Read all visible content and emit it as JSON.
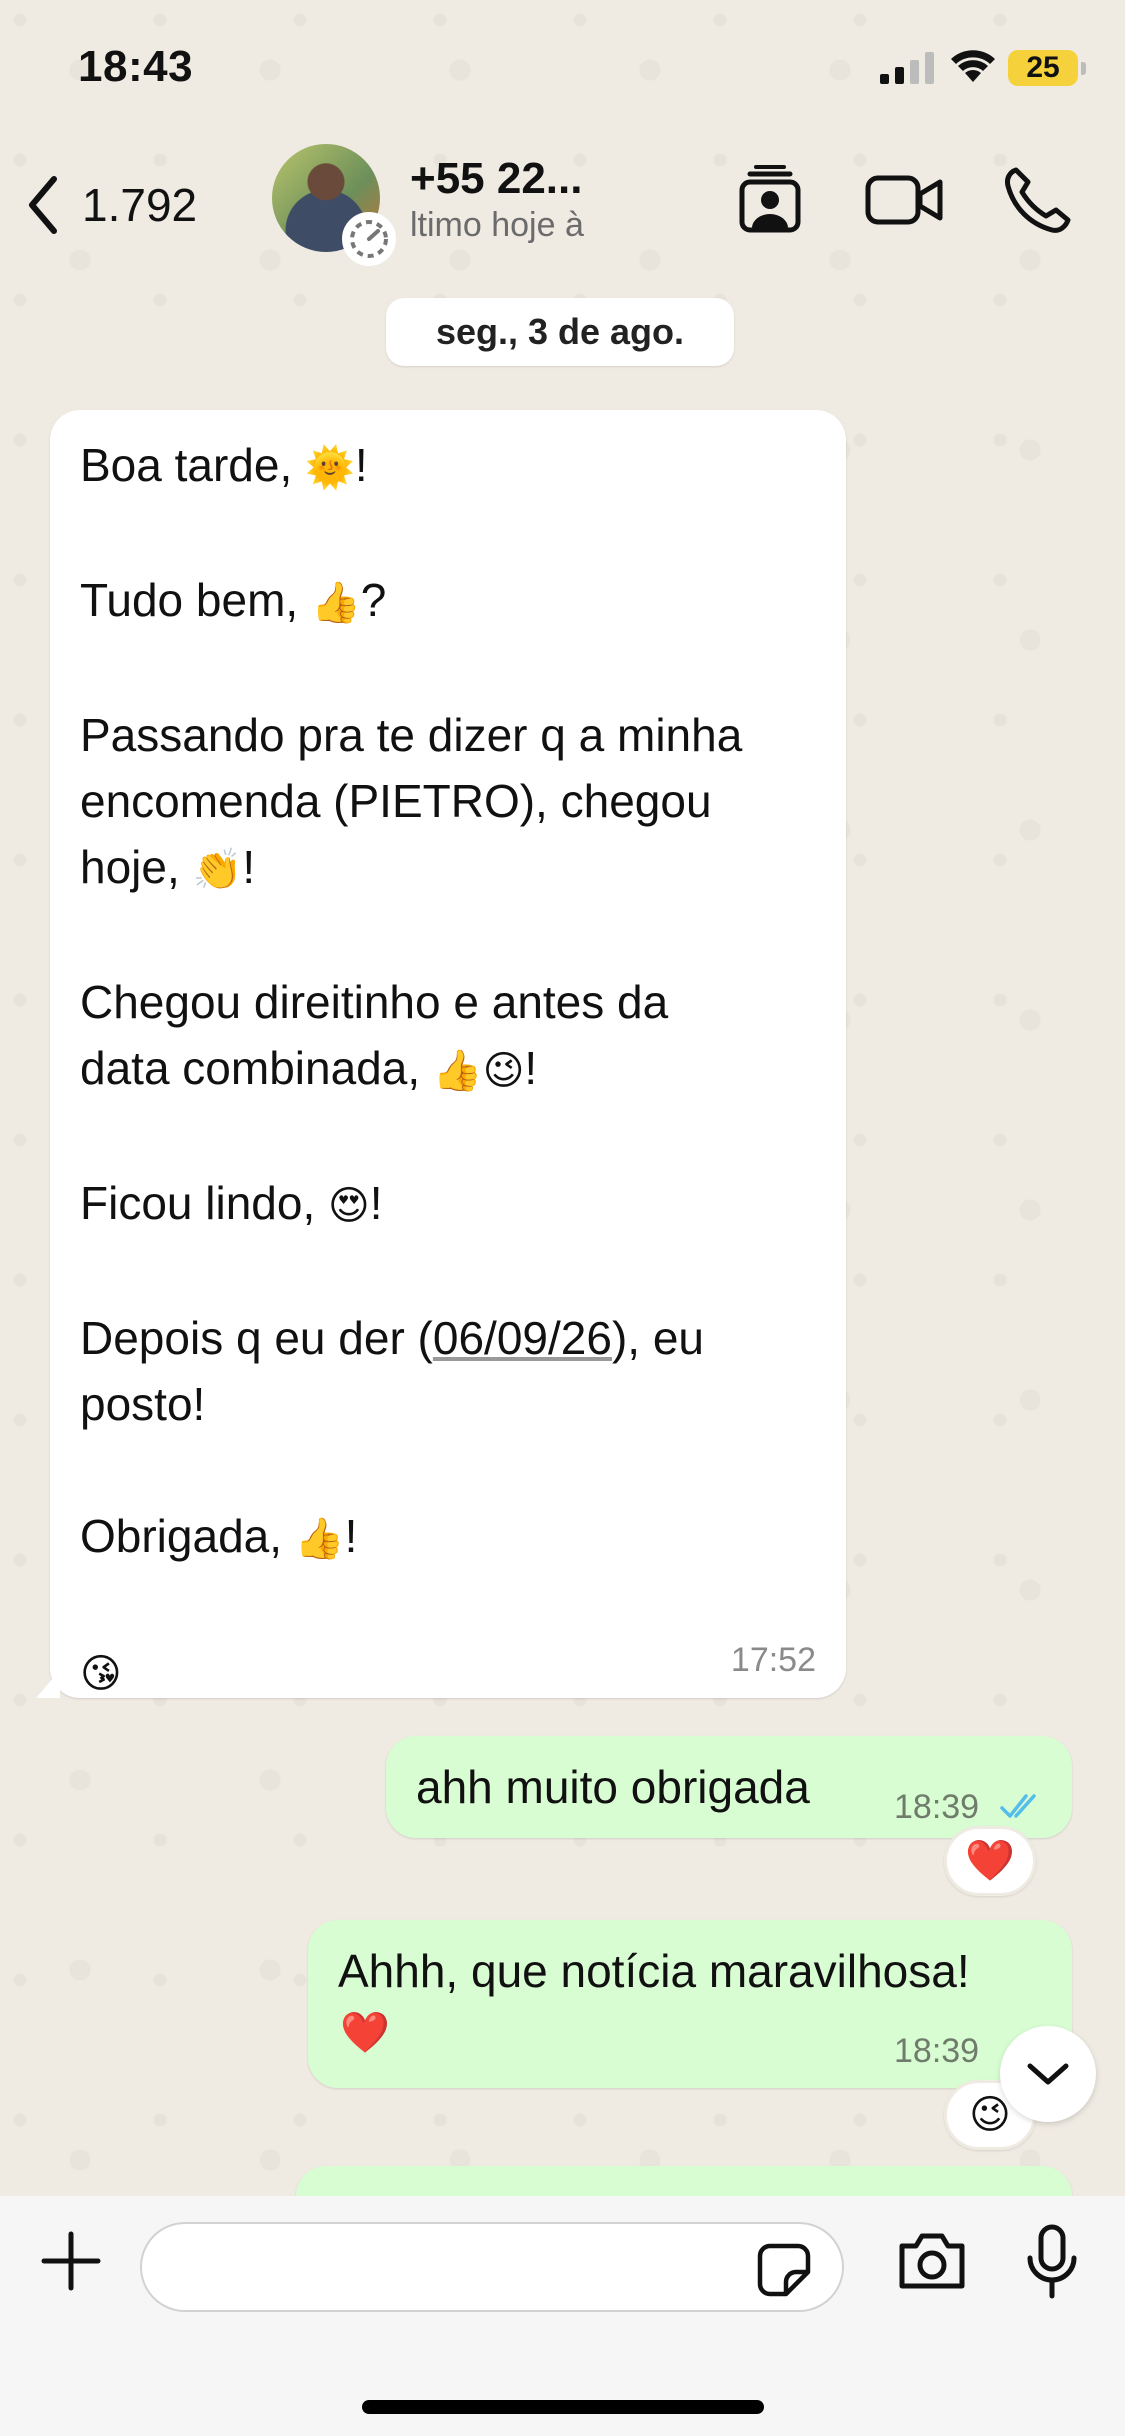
{
  "status_bar": {
    "time": "18:43",
    "battery": "25",
    "icons": [
      "signal-icon",
      "wifi-icon",
      "battery-icon"
    ]
  },
  "header": {
    "back_count": "1.792",
    "contact_name": "+55 22...",
    "contact_status": "ltimo hoje à",
    "icons": [
      "contact-card-icon",
      "video-call-icon",
      "phone-call-icon"
    ]
  },
  "date_separator": "seg., 3 de ago.",
  "incoming_message": {
    "lines": [
      {
        "text": "Boa tarde, ",
        "emoji": "🌞",
        "suffix": "!"
      },
      {
        "text": "Tudo bem, ",
        "emoji": "👍",
        "suffix": "?"
      },
      {
        "text": "Passando pra te dizer q a minha"
      },
      {
        "text": "encomenda (PIETRO), chegou"
      },
      {
        "text": "hoje, ",
        "emoji": "👏",
        "suffix": "!"
      },
      {
        "text": "Chegou direitinho e antes da"
      },
      {
        "text": "data combinada, ",
        "emoji": "👍😉",
        "suffix": "!"
      },
      {
        "text": "Ficou lindo, ",
        "emoji": "😍",
        "suffix": "!"
      },
      {
        "text": "Depois q eu der (",
        "link": "06/09/26",
        "suffix": "), eu"
      },
      {
        "text": "posto!"
      },
      {
        "text": "Obrigada, ",
        "emoji": "👍",
        "suffix": "!"
      },
      {
        "emoji": "😘"
      }
    ],
    "time": "17:52"
  },
  "outgoing_messages": [
    {
      "text": "ahh muito obrigada",
      "time": "18:39",
      "reaction": "❤️"
    },
    {
      "text": "Ahhh, que notícia maravilhosa!",
      "emoji": "❤️",
      "time": "18:39",
      "reaction": "😉"
    }
  ],
  "colors": {
    "chat_background": "#efeae2",
    "outgoing_bubble": "#d9fdd3",
    "incoming_bubble": "#ffffff",
    "read_ticks": "#53bdeb"
  }
}
